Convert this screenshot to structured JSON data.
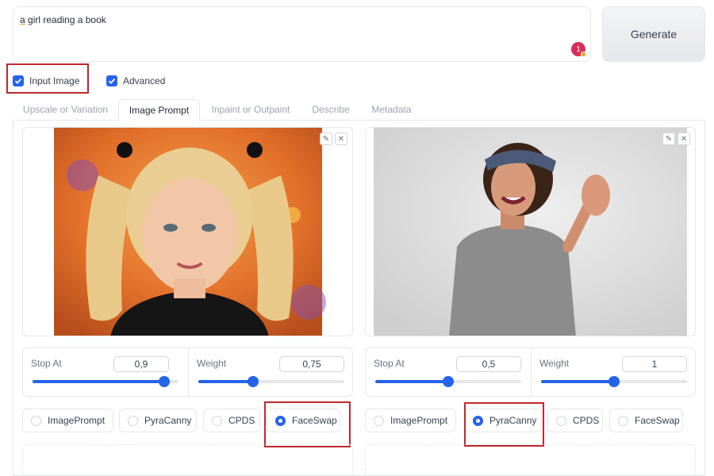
{
  "prompt": {
    "text_a": "a",
    "text_rest": " girl reading a book",
    "token_badge": "1"
  },
  "generate": {
    "label": "Generate"
  },
  "options": {
    "input_image": {
      "label": "Input Image",
      "checked": true
    },
    "advanced": {
      "label": "Advanced",
      "checked": true
    }
  },
  "tabs": [
    "Upscale or Variation",
    "Image Prompt",
    "Inpaint or Outpaint",
    "Describe",
    "Metadata"
  ],
  "active_tab": "Image Prompt",
  "panels": [
    {
      "stop_at_label": "Stop At",
      "stop_at_value": "0,9",
      "stop_at_fraction": 0.9,
      "weight_label": "Weight",
      "weight_value": "0,75",
      "weight_fraction": 0.375,
      "types": [
        "ImagePrompt",
        "PyraCanny",
        "CPDS",
        "FaceSwap"
      ],
      "selected_type": "FaceSwap"
    },
    {
      "stop_at_label": "Stop At",
      "stop_at_value": "0,5",
      "stop_at_fraction": 0.5,
      "weight_label": "Weight",
      "weight_value": "1",
      "weight_fraction": 0.5,
      "types": [
        "ImagePrompt",
        "PyraCanny",
        "CPDS",
        "FaceSwap"
      ],
      "selected_type": "PyraCanny"
    }
  ],
  "colors": {
    "accent": "#2563eb",
    "highlight_box": "#c0282e",
    "badge": "#d72d55"
  },
  "icons": {
    "edit": "pencil-icon",
    "close": "close-icon",
    "check": "checkmark-icon"
  }
}
